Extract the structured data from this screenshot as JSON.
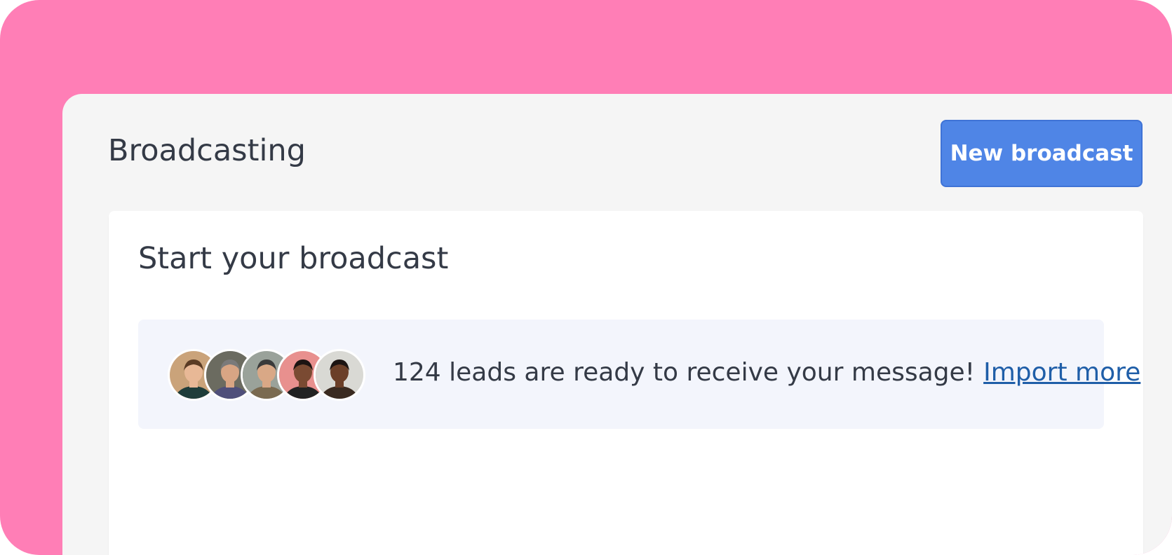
{
  "page": {
    "title": "Broadcasting",
    "new_button_label": "New broadcast"
  },
  "card": {
    "title": "Start your broadcast",
    "leads_message": "124 leads are ready to receive your message!",
    "import_link": "Import more"
  },
  "avatars": [
    {
      "name": "avatar-man-smiling",
      "bg": "#caa37a",
      "skin": "#e8b896",
      "hair": "#5a3b24",
      "shirt": "#1f3d3a"
    },
    {
      "name": "avatar-woman-glasses",
      "bg": "#6b6b60",
      "skin": "#d8a584",
      "hair": "#7a7a7a",
      "shirt": "#4f4f7a"
    },
    {
      "name": "avatar-man-cap",
      "bg": "#9aa29a",
      "skin": "#d9a886",
      "hair": "#3a3a3a",
      "shirt": "#7a6a50"
    },
    {
      "name": "avatar-woman-pink",
      "bg": "#e8908e",
      "skin": "#7a4a32",
      "hair": "#1c1412",
      "shirt": "#222222"
    },
    {
      "name": "avatar-woman-portrait",
      "bg": "#d9d9d4",
      "skin": "#6b3f28",
      "hair": "#1c1412",
      "shirt": "#3a2a20"
    }
  ],
  "colors": {
    "brand_pink": "#ff7eb6",
    "primary_button": "#4f85e6",
    "link": "#1f5ea8",
    "banner_bg": "#f3f5fc"
  }
}
